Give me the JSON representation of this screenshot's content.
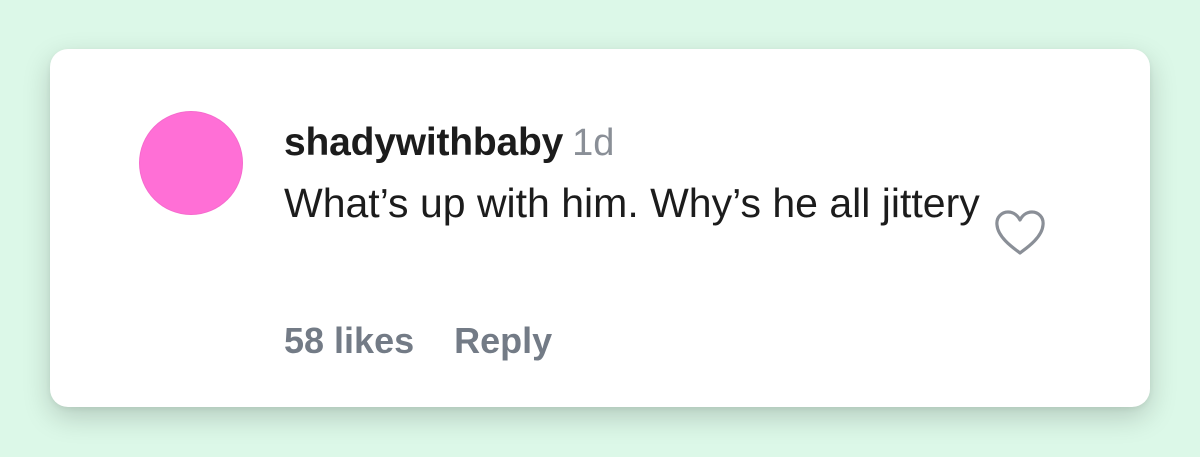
{
  "comment": {
    "username": "shadywithbaby",
    "timestamp": "1d",
    "text": "What’s up with him. Why’s he all jittery",
    "likes_label": "58 likes",
    "reply_label": "Reply",
    "like_icon": "heart-outline-icon"
  },
  "colors": {
    "background": "#dcf8e8",
    "card": "#ffffff",
    "avatar": "#ff6fd6",
    "text_primary": "#1c1c1c",
    "text_secondary": "#737b86"
  }
}
